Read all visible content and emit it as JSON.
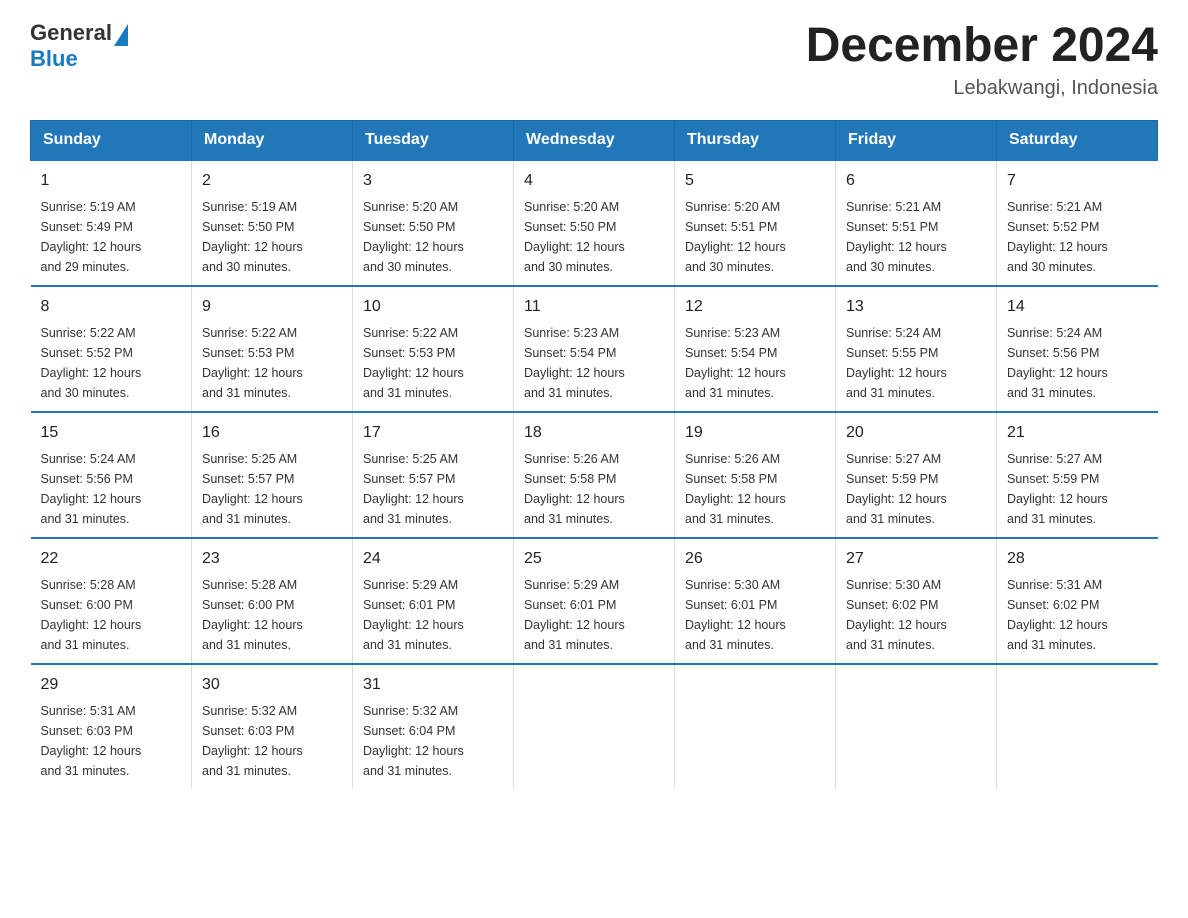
{
  "header": {
    "logo": {
      "general": "General",
      "blue": "Blue"
    },
    "title": "December 2024",
    "location": "Lebakwangi, Indonesia"
  },
  "days_of_week": [
    "Sunday",
    "Monday",
    "Tuesday",
    "Wednesday",
    "Thursday",
    "Friday",
    "Saturday"
  ],
  "weeks": [
    [
      {
        "day": "1",
        "sunrise": "5:19 AM",
        "sunset": "5:49 PM",
        "daylight": "12 hours and 29 minutes."
      },
      {
        "day": "2",
        "sunrise": "5:19 AM",
        "sunset": "5:50 PM",
        "daylight": "12 hours and 30 minutes."
      },
      {
        "day": "3",
        "sunrise": "5:20 AM",
        "sunset": "5:50 PM",
        "daylight": "12 hours and 30 minutes."
      },
      {
        "day": "4",
        "sunrise": "5:20 AM",
        "sunset": "5:50 PM",
        "daylight": "12 hours and 30 minutes."
      },
      {
        "day": "5",
        "sunrise": "5:20 AM",
        "sunset": "5:51 PM",
        "daylight": "12 hours and 30 minutes."
      },
      {
        "day": "6",
        "sunrise": "5:21 AM",
        "sunset": "5:51 PM",
        "daylight": "12 hours and 30 minutes."
      },
      {
        "day": "7",
        "sunrise": "5:21 AM",
        "sunset": "5:52 PM",
        "daylight": "12 hours and 30 minutes."
      }
    ],
    [
      {
        "day": "8",
        "sunrise": "5:22 AM",
        "sunset": "5:52 PM",
        "daylight": "12 hours and 30 minutes."
      },
      {
        "day": "9",
        "sunrise": "5:22 AM",
        "sunset": "5:53 PM",
        "daylight": "12 hours and 31 minutes."
      },
      {
        "day": "10",
        "sunrise": "5:22 AM",
        "sunset": "5:53 PM",
        "daylight": "12 hours and 31 minutes."
      },
      {
        "day": "11",
        "sunrise": "5:23 AM",
        "sunset": "5:54 PM",
        "daylight": "12 hours and 31 minutes."
      },
      {
        "day": "12",
        "sunrise": "5:23 AM",
        "sunset": "5:54 PM",
        "daylight": "12 hours and 31 minutes."
      },
      {
        "day": "13",
        "sunrise": "5:24 AM",
        "sunset": "5:55 PM",
        "daylight": "12 hours and 31 minutes."
      },
      {
        "day": "14",
        "sunrise": "5:24 AM",
        "sunset": "5:56 PM",
        "daylight": "12 hours and 31 minutes."
      }
    ],
    [
      {
        "day": "15",
        "sunrise": "5:24 AM",
        "sunset": "5:56 PM",
        "daylight": "12 hours and 31 minutes."
      },
      {
        "day": "16",
        "sunrise": "5:25 AM",
        "sunset": "5:57 PM",
        "daylight": "12 hours and 31 minutes."
      },
      {
        "day": "17",
        "sunrise": "5:25 AM",
        "sunset": "5:57 PM",
        "daylight": "12 hours and 31 minutes."
      },
      {
        "day": "18",
        "sunrise": "5:26 AM",
        "sunset": "5:58 PM",
        "daylight": "12 hours and 31 minutes."
      },
      {
        "day": "19",
        "sunrise": "5:26 AM",
        "sunset": "5:58 PM",
        "daylight": "12 hours and 31 minutes."
      },
      {
        "day": "20",
        "sunrise": "5:27 AM",
        "sunset": "5:59 PM",
        "daylight": "12 hours and 31 minutes."
      },
      {
        "day": "21",
        "sunrise": "5:27 AM",
        "sunset": "5:59 PM",
        "daylight": "12 hours and 31 minutes."
      }
    ],
    [
      {
        "day": "22",
        "sunrise": "5:28 AM",
        "sunset": "6:00 PM",
        "daylight": "12 hours and 31 minutes."
      },
      {
        "day": "23",
        "sunrise": "5:28 AM",
        "sunset": "6:00 PM",
        "daylight": "12 hours and 31 minutes."
      },
      {
        "day": "24",
        "sunrise": "5:29 AM",
        "sunset": "6:01 PM",
        "daylight": "12 hours and 31 minutes."
      },
      {
        "day": "25",
        "sunrise": "5:29 AM",
        "sunset": "6:01 PM",
        "daylight": "12 hours and 31 minutes."
      },
      {
        "day": "26",
        "sunrise": "5:30 AM",
        "sunset": "6:01 PM",
        "daylight": "12 hours and 31 minutes."
      },
      {
        "day": "27",
        "sunrise": "5:30 AM",
        "sunset": "6:02 PM",
        "daylight": "12 hours and 31 minutes."
      },
      {
        "day": "28",
        "sunrise": "5:31 AM",
        "sunset": "6:02 PM",
        "daylight": "12 hours and 31 minutes."
      }
    ],
    [
      {
        "day": "29",
        "sunrise": "5:31 AM",
        "sunset": "6:03 PM",
        "daylight": "12 hours and 31 minutes."
      },
      {
        "day": "30",
        "sunrise": "5:32 AM",
        "sunset": "6:03 PM",
        "daylight": "12 hours and 31 minutes."
      },
      {
        "day": "31",
        "sunrise": "5:32 AM",
        "sunset": "6:04 PM",
        "daylight": "12 hours and 31 minutes."
      },
      null,
      null,
      null,
      null
    ]
  ],
  "labels": {
    "sunrise": "Sunrise:",
    "sunset": "Sunset:",
    "daylight": "Daylight:"
  }
}
